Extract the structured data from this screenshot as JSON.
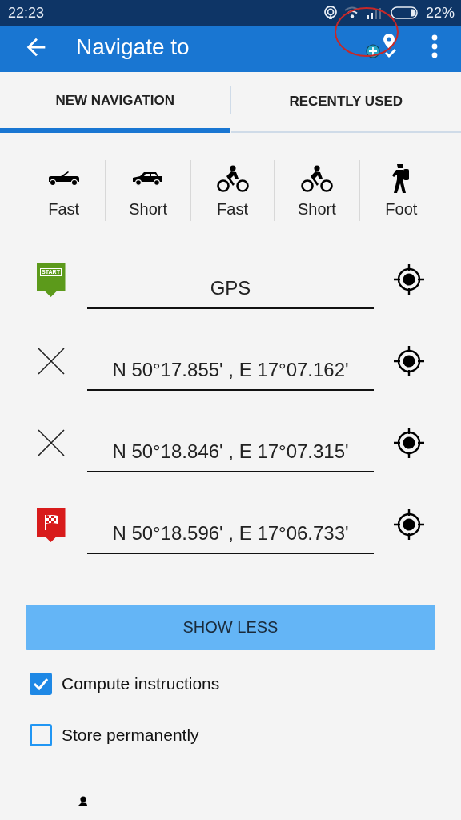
{
  "status_bar": {
    "time": "22:23",
    "battery": "22%"
  },
  "app_bar": {
    "title": "Navigate to"
  },
  "tabs": [
    {
      "label": "NEW NAVIGATION",
      "selected": true
    },
    {
      "label": "RECENTLY USED",
      "selected": false
    }
  ],
  "route_modes": [
    {
      "kind": "convertible",
      "label": "Fast"
    },
    {
      "kind": "suv",
      "label": "Short"
    },
    {
      "kind": "bike",
      "label": "Fast"
    },
    {
      "kind": "bike",
      "label": "Short"
    },
    {
      "kind": "foot",
      "label": "Foot"
    }
  ],
  "waypoints": [
    {
      "kind": "start",
      "badge": "START",
      "value": "GPS"
    },
    {
      "kind": "via",
      "value": "N 50°17.855' , E 17°07.162'"
    },
    {
      "kind": "via",
      "value": "N 50°18.846' , E 17°07.315'"
    },
    {
      "kind": "finish",
      "value": "N 50°18.596' , E 17°06.733'"
    }
  ],
  "show_less_button": {
    "label": "SHOW LESS"
  },
  "options": [
    {
      "label": "Compute instructions",
      "checked": true
    },
    {
      "label": "Store permanently",
      "checked": false
    }
  ]
}
